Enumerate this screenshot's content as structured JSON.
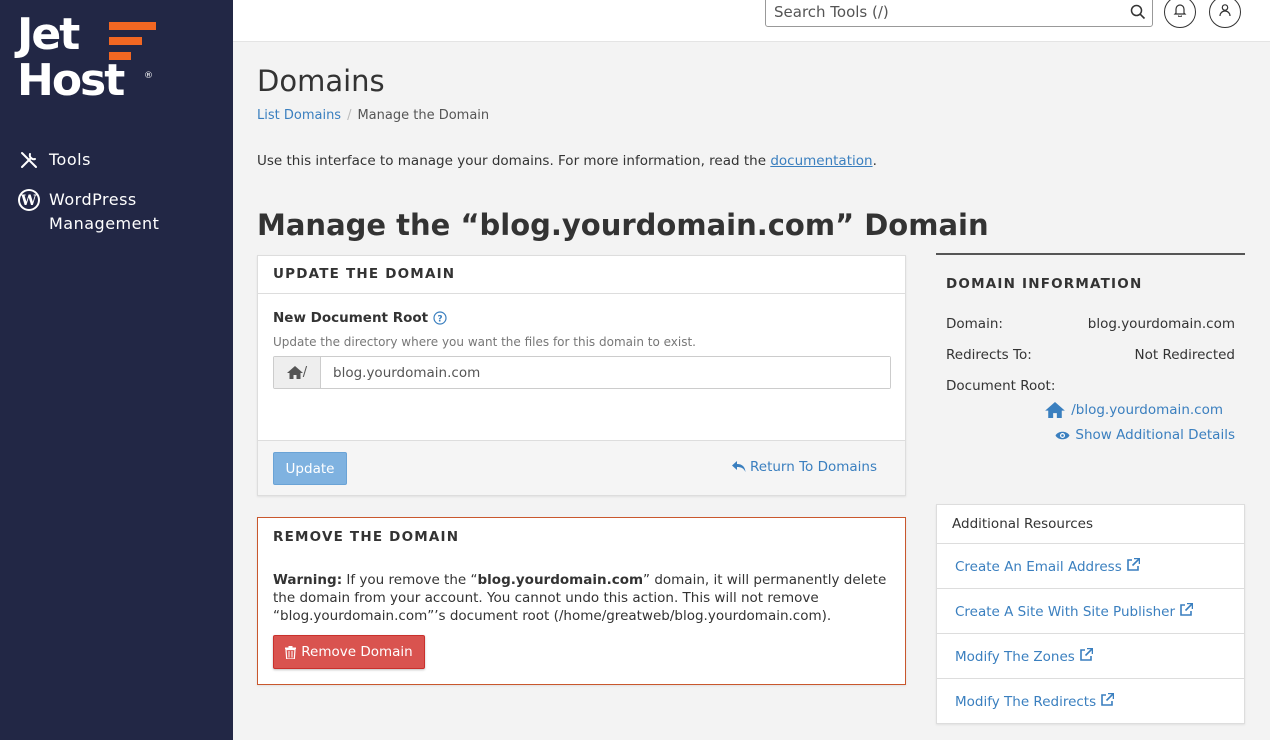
{
  "brand": {
    "line1": "Jet",
    "line2": "Host",
    "reg": "®",
    "accent": "#f26722",
    "sidebar_bg": "#222745"
  },
  "sidebar": {
    "items": [
      {
        "label": "Tools",
        "icon": "tools-icon"
      },
      {
        "label": "WordPress",
        "label2": "Management",
        "icon": "wordpress-icon"
      }
    ]
  },
  "topbar": {
    "search_placeholder": "Search Tools (/)"
  },
  "page": {
    "title": "Domains",
    "breadcrumb": {
      "link": "List Domains",
      "sep": "/",
      "current": "Manage the Domain"
    },
    "intro": "Use this interface to manage your domains. For more information, read the ",
    "intro_link": "documentation",
    "intro_end": ".",
    "heading": "Manage the “blog.yourdomain.com” Domain"
  },
  "update_panel": {
    "title": "UPDATE THE DOMAIN",
    "field_label": "New Document Root",
    "help": "Update the directory where you want the files for this domain to exist.",
    "addon": "/",
    "value": "blog.yourdomain.com",
    "update_button": "Update",
    "return_link": "Return To Domains"
  },
  "remove_panel": {
    "title": "REMOVE THE DOMAIN",
    "warning_label": "Warning:",
    "warning_1": " If you remove the “",
    "warning_domain": "blog.yourdomain.com",
    "warning_2": "” domain, it will permanently delete the domain from your account. You cannot undo this action. This will not remove “blog.yourdomain.com”’s document root (/home/greatweb/blog.yourdomain.com).",
    "remove_button": "Remove Domain"
  },
  "domain_info": {
    "title": "DOMAIN INFORMATION",
    "domain_label": "Domain:",
    "domain_value": "blog.yourdomain.com",
    "redirects_label": "Redirects To:",
    "redirects_value": "Not Redirected",
    "docroot_label": "Document Root:",
    "docroot_value": "/blog.yourdomain.com",
    "show_details": "Show Additional Details"
  },
  "resources": {
    "title": "Additional Resources",
    "items": [
      "Create An Email Address",
      "Create A Site With Site Publisher",
      "Modify The Zones",
      "Modify The Redirects"
    ]
  }
}
